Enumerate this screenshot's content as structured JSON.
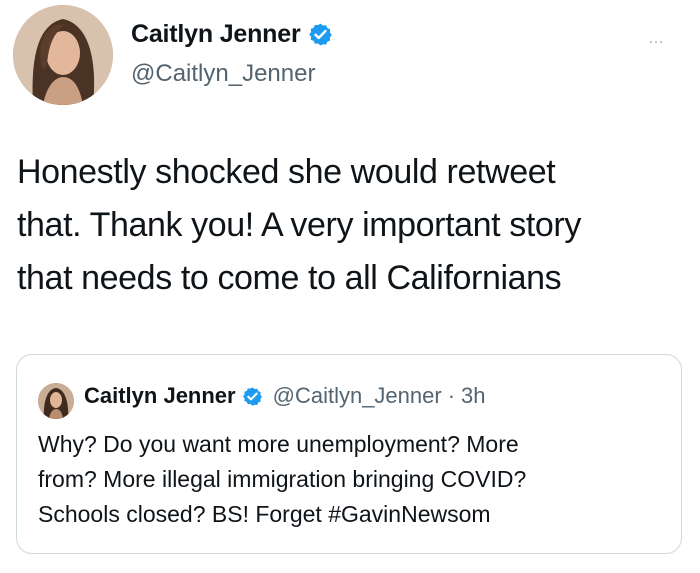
{
  "tweet": {
    "author": {
      "display_name": "Caitlyn Jenner",
      "handle": "@Caitlyn_Jenner",
      "verified_icon": "verified-badge-icon",
      "avatar": "profile-photo"
    },
    "more_label": "…",
    "text": "Honestly shocked she would retweet\nthat. Thank you! A very important story\nthat needs to come to all Californians"
  },
  "quoted_tweet": {
    "author": {
      "display_name": "Caitlyn Jenner",
      "handle": "@Caitlyn_Jenner",
      "verified_icon": "verified-badge-icon"
    },
    "separator": "·",
    "time": "3h",
    "text": "Why? Do you want more unemployment? More\nfrom? More illegal immigration bringing COVID?\nSchools closed? BS! Forget #GavinNewsom"
  },
  "colors": {
    "verified_blue": "#1d9bf0",
    "text_primary": "#0f1419",
    "text_secondary": "#536471",
    "border": "#cfd9de"
  }
}
